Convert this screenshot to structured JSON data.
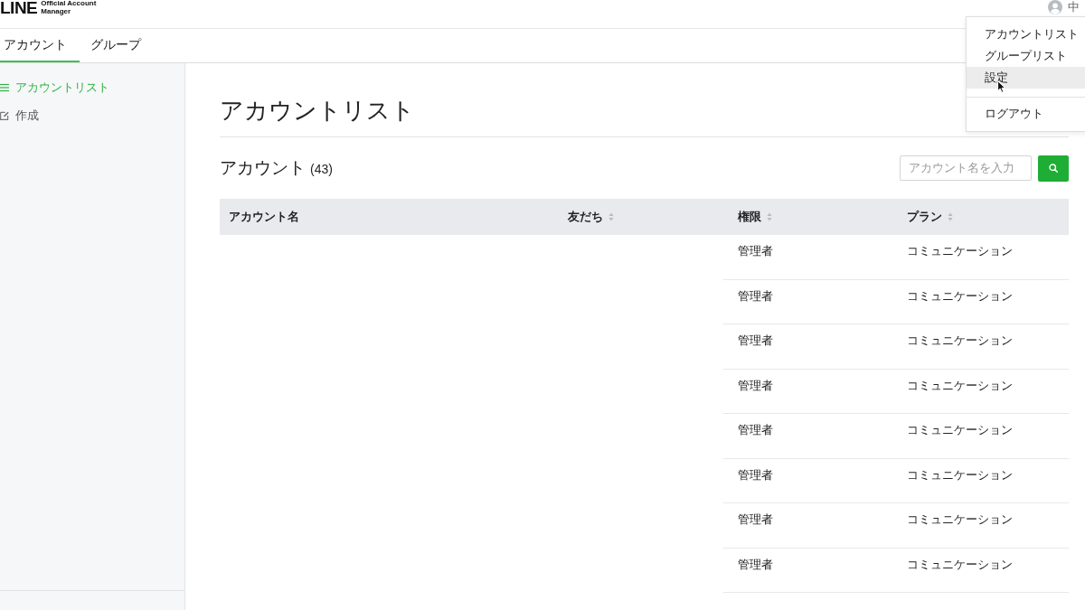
{
  "header": {
    "logo": {
      "wordmark": "LINE",
      "subtitle_1": "Official Account",
      "subtitle_2": "Manager"
    },
    "user": {
      "name": "中"
    }
  },
  "user_menu": {
    "items": [
      {
        "label": "アカウントリスト",
        "kind": "link",
        "selected": false
      },
      {
        "label": "グループリスト",
        "kind": "link",
        "selected": false
      },
      {
        "label": "設定",
        "kind": "link",
        "selected": true
      },
      {
        "label": "ログアウト",
        "kind": "logout",
        "selected": false
      }
    ]
  },
  "tabs": [
    {
      "label": "アカウント",
      "selected": true
    },
    {
      "label": "グループ",
      "selected": false
    }
  ],
  "sidebar": {
    "items": [
      {
        "label": "アカウントリスト",
        "kind": "list",
        "selected": true
      },
      {
        "label": "作成",
        "kind": "compose",
        "selected": false
      }
    ]
  },
  "page": {
    "title": "アカウントリスト",
    "section_title": "アカウント",
    "count": "(43)",
    "search": {
      "placeholder": "アカウント名を入力"
    }
  },
  "table": {
    "columns": [
      {
        "label": "アカウント名",
        "sortable": false
      },
      {
        "label": "友だち",
        "sortable": true
      },
      {
        "label": "権限",
        "sortable": true
      },
      {
        "label": "プラン",
        "sortable": true
      }
    ],
    "rows": [
      {
        "role": "管理者",
        "plan": "コミュニケーション"
      },
      {
        "role": "管理者",
        "plan": "コミュニケーション"
      },
      {
        "role": "管理者",
        "plan": "コミュニケーション"
      },
      {
        "role": "管理者",
        "plan": "コミュニケーション"
      },
      {
        "role": "管理者",
        "plan": "コミュニケーション"
      },
      {
        "role": "管理者",
        "plan": "コミュニケーション"
      },
      {
        "role": "管理者",
        "plan": "コミュニケーション"
      },
      {
        "role": "管理者",
        "plan": "コミュニケーション"
      }
    ]
  }
}
